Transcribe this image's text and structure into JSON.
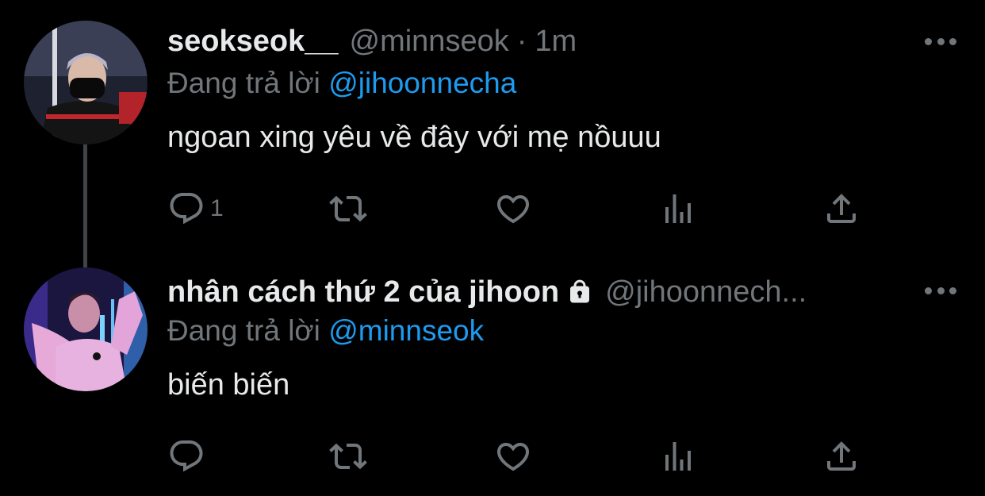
{
  "tweets": [
    {
      "name": "seokseok__",
      "handle": "@minnseok",
      "separator": "·",
      "time": "1m",
      "replying_label": "Đang trả lời",
      "replying_to": "@jihoonnecha",
      "text": "ngoan xing yêu về đây với mẹ nồuuu",
      "reply_count": "1",
      "protected": false
    },
    {
      "name": "nhân cách thứ 2 của jihoon",
      "handle": "@jihoonnech...",
      "replying_label": "Đang trả lời",
      "replying_to": "@minnseok",
      "text": "biến biến",
      "reply_count": "",
      "protected": true
    }
  ],
  "icons": {
    "reply": "reply-icon",
    "retweet": "retweet-icon",
    "like": "heart-icon",
    "views": "views-icon",
    "share": "share-icon",
    "more": "more-icon",
    "lock": "lock-icon"
  },
  "colors": {
    "background": "#000000",
    "text": "#e7e9ea",
    "muted": "#71767b",
    "accent": "#1d9bf0",
    "thread_line": "#3f4448"
  }
}
